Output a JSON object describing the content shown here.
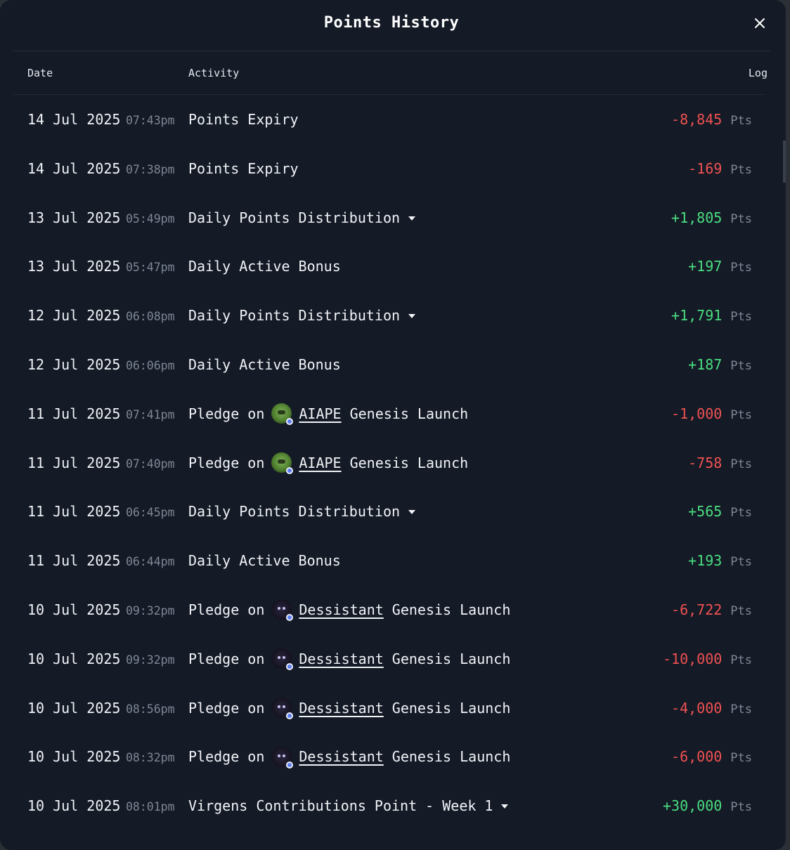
{
  "modal": {
    "title": "Points History",
    "close_icon": "close-icon"
  },
  "columns": {
    "date": "Date",
    "activity": "Activity",
    "log": "Log"
  },
  "colors": {
    "negative": "#f05252",
    "positive": "#4ade80",
    "background": "#141a26"
  },
  "rows": [
    {
      "date": "14 Jul 2025",
      "time": "07:43pm",
      "activity": "Points Expiry",
      "amount": "-8,845",
      "unit": "Pts",
      "sign": "neg"
    },
    {
      "date": "14 Jul 2025",
      "time": "07:38pm",
      "activity": "Points Expiry",
      "amount": "-169",
      "unit": "Pts",
      "sign": "neg"
    },
    {
      "date": "13 Jul 2025",
      "time": "05:49pm",
      "activity": "Daily Points Distribution",
      "amount": "+1,805",
      "unit": "Pts",
      "sign": "pos"
    },
    {
      "date": "13 Jul 2025",
      "time": "05:47pm",
      "activity": "Daily Active Bonus",
      "amount": "+197",
      "unit": "Pts",
      "sign": "pos"
    },
    {
      "date": "12 Jul 2025",
      "time": "06:08pm",
      "activity": "Daily Points Distribution",
      "amount": "+1,791",
      "unit": "Pts",
      "sign": "pos"
    },
    {
      "date": "12 Jul 2025",
      "time": "06:06pm",
      "activity": "Daily Active Bonus",
      "amount": "+187",
      "unit": "Pts",
      "sign": "pos"
    },
    {
      "date": "11 Jul 2025",
      "time": "07:41pm",
      "activity_prefix": "Pledge on",
      "token": "AIAPE",
      "activity_suffix": "Genesis Launch",
      "amount": "-1,000",
      "unit": "Pts",
      "sign": "neg"
    },
    {
      "date": "11 Jul 2025",
      "time": "07:40pm",
      "activity_prefix": "Pledge on",
      "token": "AIAPE",
      "activity_suffix": "Genesis Launch",
      "amount": "-758",
      "unit": "Pts",
      "sign": "neg"
    },
    {
      "date": "11 Jul 2025",
      "time": "06:45pm",
      "activity": "Daily Points Distribution",
      "amount": "+565",
      "unit": "Pts",
      "sign": "pos"
    },
    {
      "date": "11 Jul 2025",
      "time": "06:44pm",
      "activity": "Daily Active Bonus",
      "amount": "+193",
      "unit": "Pts",
      "sign": "pos"
    },
    {
      "date": "10 Jul 2025",
      "time": "09:32pm",
      "activity_prefix": "Pledge on",
      "token": "Dessistant",
      "activity_suffix": "Genesis Launch",
      "amount": "-6,722",
      "unit": "Pts",
      "sign": "neg"
    },
    {
      "date": "10 Jul 2025",
      "time": "09:32pm",
      "activity_prefix": "Pledge on",
      "token": "Dessistant",
      "activity_suffix": "Genesis Launch",
      "amount": "-10,000",
      "unit": "Pts",
      "sign": "neg"
    },
    {
      "date": "10 Jul 2025",
      "time": "08:56pm",
      "activity_prefix": "Pledge on",
      "token": "Dessistant",
      "activity_suffix": "Genesis Launch",
      "amount": "-4,000",
      "unit": "Pts",
      "sign": "neg"
    },
    {
      "date": "10 Jul 2025",
      "time": "08:32pm",
      "activity_prefix": "Pledge on",
      "token": "Dessistant",
      "activity_suffix": "Genesis Launch",
      "amount": "-6,000",
      "unit": "Pts",
      "sign": "neg"
    },
    {
      "date": "10 Jul 2025",
      "time": "08:01pm",
      "activity": "Virgens Contributions Point - Week 1",
      "amount": "+30,000",
      "unit": "Pts",
      "sign": "pos"
    }
  ]
}
